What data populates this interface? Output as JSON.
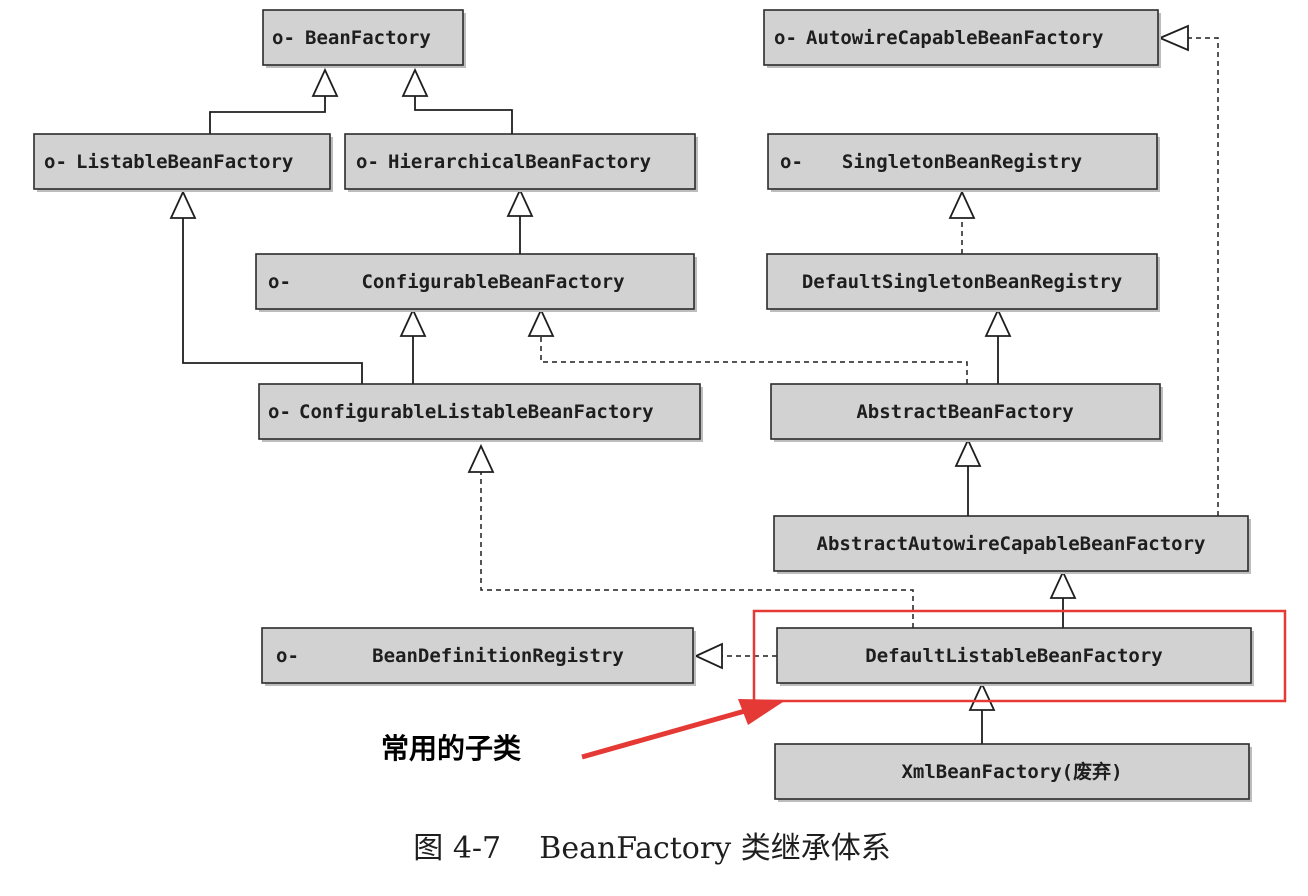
{
  "nodes": {
    "bean_factory": {
      "label": "BeanFactory",
      "interface": true
    },
    "autowire_capable_bean_factory": {
      "label": "AutowireCapableBeanFactory",
      "interface": true
    },
    "listable_bean_factory": {
      "label": "ListableBeanFactory",
      "interface": true
    },
    "hierarchical_bean_factory": {
      "label": "HierarchicalBeanFactory",
      "interface": true
    },
    "singleton_bean_registry": {
      "label": "SingletonBeanRegistry",
      "interface": true
    },
    "configurable_bean_factory": {
      "label": "ConfigurableBeanFactory",
      "interface": true
    },
    "default_singleton_bean_registry": {
      "label": "DefaultSingletonBeanRegistry",
      "interface": false
    },
    "configurable_listable_bean_factory": {
      "label": "ConfigurableListableBeanFactory",
      "interface": true
    },
    "abstract_bean_factory": {
      "label": "AbstractBeanFactory",
      "interface": false
    },
    "abstract_autowire_capable_bean_factory": {
      "label": "AbstractAutowireCapableBeanFactory",
      "interface": false
    },
    "bean_definition_registry": {
      "label": "BeanDefinitionRegistry",
      "interface": true
    },
    "default_listable_bean_factory": {
      "label": "DefaultListableBeanFactory",
      "interface": false
    },
    "xml_bean_factory": {
      "label": "XmlBeanFactory(废弃)",
      "interface": false
    }
  },
  "interface_marker": "o-",
  "callout": {
    "label": "常用的子类",
    "highlight_color": "#e53935"
  },
  "caption": {
    "label": "图 4-7    BeanFactory 类继承体系"
  }
}
